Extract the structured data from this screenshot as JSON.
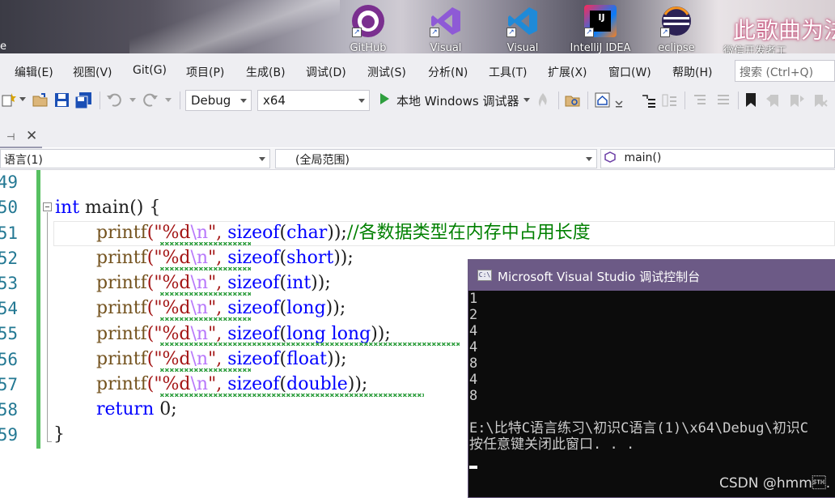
{
  "desktop": {
    "left_label": "e",
    "icons": [
      {
        "label": "GitHub",
        "icon": "github-icon"
      },
      {
        "label": "Visual",
        "icon": "visual-studio-icon"
      },
      {
        "label": "Visual",
        "icon": "vscode-icon"
      },
      {
        "label": "IntelliJ IDEA",
        "icon": "intellij-idea-icon"
      },
      {
        "label": "eclipse",
        "icon": "eclipse-icon"
      },
      {
        "label": "微信开发者工",
        "icon": "wechat-devtools-icon"
      }
    ],
    "banner_text": "此歌曲为法"
  },
  "menubar": {
    "items": [
      "编辑(E)",
      "视图(V)",
      "Git(G)",
      "项目(P)",
      "生成(B)",
      "调试(D)",
      "测试(S)",
      "分析(N)",
      "工具(T)",
      "扩展(X)",
      "窗口(W)",
      "帮助(H)"
    ],
    "search_placeholder": "搜索 (Ctrl+Q)"
  },
  "toolbar": {
    "config": "Debug",
    "platform": "x64",
    "run_label": "本地 Windows 调试器",
    "colors": {
      "run": "#2e9e3e",
      "save": "#1b4fb5"
    }
  },
  "navbar": {
    "project": "语言(1)",
    "scope": "(全局范围)",
    "member": "main()"
  },
  "editor": {
    "line_numbers": [
      "49",
      "50",
      "51",
      "52",
      "53",
      "54",
      "55",
      "56",
      "57",
      "58",
      "59"
    ],
    "lines": [
      {
        "kw": "int",
        "rest": " main() {"
      },
      {
        "type": "char",
        "comment": "//各数据类型在内存中占用长度"
      },
      {
        "type": "short"
      },
      {
        "type": "int"
      },
      {
        "type": "long"
      },
      {
        "type": "long long"
      },
      {
        "type": "float"
      },
      {
        "type": "double"
      },
      {
        "kw": "return",
        "rest": " 0;"
      },
      {
        "rest": "}"
      }
    ],
    "tokens": {
      "printf": "printf",
      "fmt_open": "(\"%d",
      "escape": "\\n",
      "fmt_close": "\", ",
      "sizeof": "sizeof",
      "paren_open": "(",
      "paren_close": "));"
    }
  },
  "console": {
    "title": "Microsoft Visual Studio 调试控制台",
    "output": [
      "1",
      "2",
      "4",
      "4",
      "8",
      "4",
      "8"
    ],
    "path_line": "E:\\比特C语言练习\\初识C语言(1)\\x64\\Debug\\初识C",
    "close_prompt": "按任意键关闭此窗口. . ."
  },
  "watermark": "CSDN @hmm\u0002."
}
